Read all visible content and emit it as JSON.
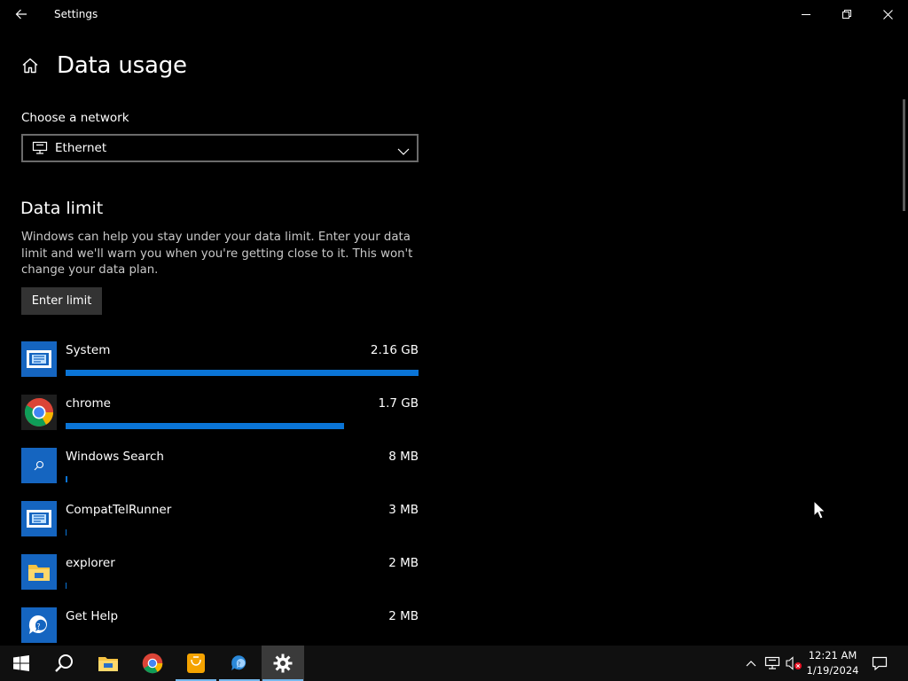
{
  "window": {
    "title": "Settings"
  },
  "page": {
    "title": "Data usage"
  },
  "network": {
    "label": "Choose a network",
    "selected": "Ethernet"
  },
  "data_limit": {
    "title": "Data limit",
    "description": "Windows can help you stay under your data limit. Enter your data limit and we'll warn you when you're getting close to it. This won't change your data plan.",
    "button_label": "Enter limit"
  },
  "apps": [
    {
      "name": "System",
      "size": "2.16 GB",
      "usage_fraction": 1.0,
      "icon": "system-app-icon"
    },
    {
      "name": "chrome",
      "size": "1.7 GB",
      "usage_fraction": 0.79,
      "icon": "chrome-icon"
    },
    {
      "name": "Windows Search",
      "size": "8 MB",
      "usage_fraction": 0.004,
      "icon": "search-app-icon"
    },
    {
      "name": "CompatTelRunner",
      "size": "3 MB",
      "usage_fraction": 0.0015,
      "icon": "system-app-icon"
    },
    {
      "name": "explorer",
      "size": "2 MB",
      "usage_fraction": 0.001,
      "icon": "folder-icon"
    },
    {
      "name": "Get Help",
      "size": "2 MB",
      "usage_fraction": 0.001,
      "icon": "get-help-icon"
    }
  ],
  "taskbar": {
    "time": "12:21 AM",
    "date": "1/19/2024"
  },
  "colors": {
    "accent": "#0a74d6",
    "background": "#000000",
    "taskbar": "#101010"
  }
}
